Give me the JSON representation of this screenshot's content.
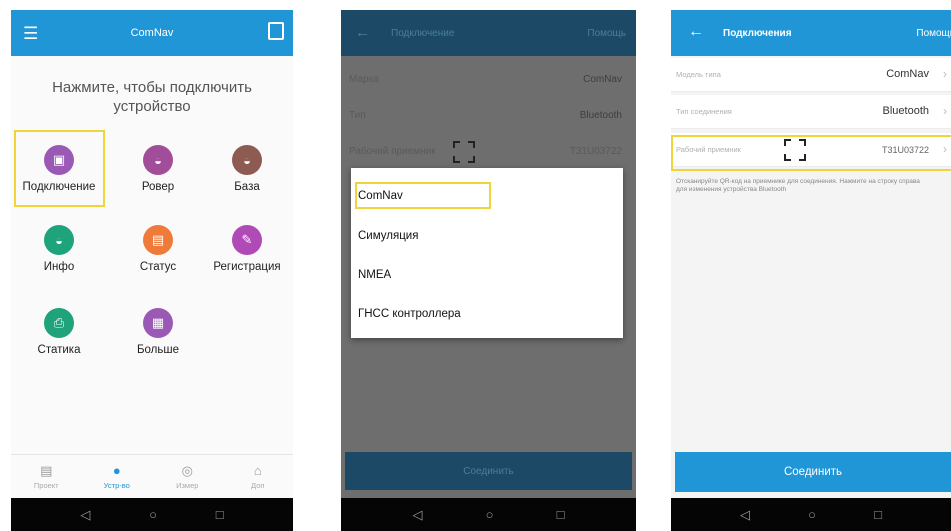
{
  "screen1": {
    "title": "ComNav",
    "prompt_line1": "Нажмите, чтобы подключить",
    "prompt_line2": "устройство",
    "items": [
      {
        "label": "Подключение",
        "color": "#9b59b6"
      },
      {
        "label": "Ровер",
        "color": "#a24d9a"
      },
      {
        "label": "База",
        "color": "#8e5b52"
      },
      {
        "label": "Инфо",
        "color": "#1fa37a"
      },
      {
        "label": "Статус",
        "color": "#f07a3a"
      },
      {
        "label": "Регистрация",
        "color": "#b04ab6"
      },
      {
        "label": "Статика",
        "color": "#1fa37a"
      },
      {
        "label": "Больше",
        "color": "#9b59b6"
      }
    ],
    "tabs": [
      {
        "label": "Проект"
      },
      {
        "label": "Устр-во"
      },
      {
        "label": "Измер"
      },
      {
        "label": "Доп"
      }
    ]
  },
  "screen2": {
    "title": "Подключение",
    "help": "Помощь",
    "rows": [
      {
        "label": "Марка",
        "value": "ComNav"
      },
      {
        "label": "Тип",
        "value": "Bluetooth"
      },
      {
        "label": "Рабочий приемник",
        "value": "T31U03722"
      }
    ],
    "options": [
      "ComNav",
      "Симуляция",
      "NMEA",
      "ГНСС контроллера"
    ],
    "connect": "Соединить"
  },
  "screen3": {
    "title": "Подключения",
    "help": "Помощь",
    "rows": [
      {
        "label": "Модель типа",
        "value": "ComNav"
      },
      {
        "label": "Тип соединения",
        "value": "Bluetooth"
      },
      {
        "label": "Рабочий приемник",
        "value": "T31U03722"
      }
    ],
    "hint": "Отсканируйте QR-код на приемнике для соединения. Нажмите на строку справа для изменения устройства Bluetooth",
    "connect": "Соединить"
  },
  "colors": {
    "accent": "#2196d6",
    "highlight": "#f0d43a",
    "dark_nav": "#050505"
  }
}
